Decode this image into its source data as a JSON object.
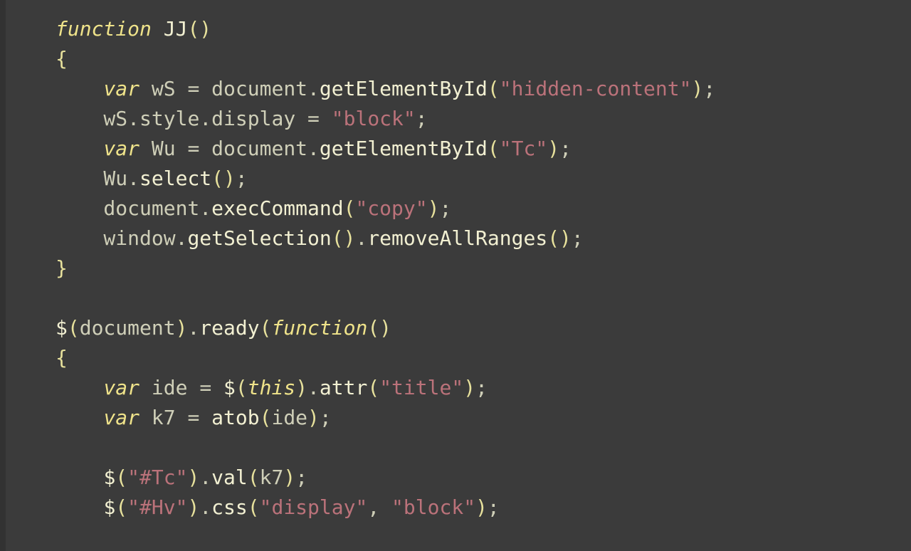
{
  "colors": {
    "background": "#3b3b3b",
    "gutter": "#323232",
    "default": "#d8d8c8",
    "keyword": "#efe38a",
    "string": "#bb727a",
    "paren": "#e7e19c"
  },
  "lines": [
    [
      {
        "t": "function",
        "c": "kw"
      },
      {
        "t": " ",
        "c": "def"
      },
      {
        "t": "JJ",
        "c": "fn"
      },
      {
        "t": "()",
        "c": "par"
      }
    ],
    [
      {
        "t": "{",
        "c": "brace"
      }
    ],
    [
      {
        "t": "    ",
        "c": "def"
      },
      {
        "t": "var",
        "c": "kw"
      },
      {
        "t": " wS ",
        "c": "def"
      },
      {
        "t": "=",
        "c": "punct"
      },
      {
        "t": " document",
        "c": "def"
      },
      {
        "t": ".",
        "c": "punct"
      },
      {
        "t": "getElementById",
        "c": "fn"
      },
      {
        "t": "(",
        "c": "par"
      },
      {
        "t": "\"hidden-content\"",
        "c": "str"
      },
      {
        "t": ")",
        "c": "par"
      },
      {
        "t": ";",
        "c": "punct"
      }
    ],
    [
      {
        "t": "    wS",
        "c": "def"
      },
      {
        "t": ".",
        "c": "punct"
      },
      {
        "t": "style",
        "c": "def"
      },
      {
        "t": ".",
        "c": "punct"
      },
      {
        "t": "display ",
        "c": "def"
      },
      {
        "t": "=",
        "c": "punct"
      },
      {
        "t": " ",
        "c": "def"
      },
      {
        "t": "\"block\"",
        "c": "str"
      },
      {
        "t": ";",
        "c": "punct"
      }
    ],
    [
      {
        "t": "    ",
        "c": "def"
      },
      {
        "t": "var",
        "c": "kw"
      },
      {
        "t": " Wu ",
        "c": "def"
      },
      {
        "t": "=",
        "c": "punct"
      },
      {
        "t": " document",
        "c": "def"
      },
      {
        "t": ".",
        "c": "punct"
      },
      {
        "t": "getElementById",
        "c": "fn"
      },
      {
        "t": "(",
        "c": "par"
      },
      {
        "t": "\"Tc\"",
        "c": "str"
      },
      {
        "t": ")",
        "c": "par"
      },
      {
        "t": ";",
        "c": "punct"
      }
    ],
    [
      {
        "t": "    Wu",
        "c": "def"
      },
      {
        "t": ".",
        "c": "punct"
      },
      {
        "t": "select",
        "c": "fn"
      },
      {
        "t": "()",
        "c": "par"
      },
      {
        "t": ";",
        "c": "punct"
      }
    ],
    [
      {
        "t": "    document",
        "c": "def"
      },
      {
        "t": ".",
        "c": "punct"
      },
      {
        "t": "execCommand",
        "c": "fn"
      },
      {
        "t": "(",
        "c": "par"
      },
      {
        "t": "\"copy\"",
        "c": "str"
      },
      {
        "t": ")",
        "c": "par"
      },
      {
        "t": ";",
        "c": "punct"
      }
    ],
    [
      {
        "t": "    window",
        "c": "def"
      },
      {
        "t": ".",
        "c": "punct"
      },
      {
        "t": "getSelection",
        "c": "fn"
      },
      {
        "t": "()",
        "c": "par"
      },
      {
        "t": ".",
        "c": "punct"
      },
      {
        "t": "removeAllRanges",
        "c": "fn"
      },
      {
        "t": "()",
        "c": "par"
      },
      {
        "t": ";",
        "c": "punct"
      }
    ],
    [
      {
        "t": "}",
        "c": "brace"
      }
    ],
    [
      {
        "t": "",
        "c": "def"
      }
    ],
    [
      {
        "t": "$",
        "c": "fn"
      },
      {
        "t": "(",
        "c": "par"
      },
      {
        "t": "document",
        "c": "def"
      },
      {
        "t": ")",
        "c": "par"
      },
      {
        "t": ".",
        "c": "punct"
      },
      {
        "t": "ready",
        "c": "fn"
      },
      {
        "t": "(",
        "c": "par"
      },
      {
        "t": "function",
        "c": "kw"
      },
      {
        "t": "()",
        "c": "par"
      }
    ],
    [
      {
        "t": "{",
        "c": "brace"
      }
    ],
    [
      {
        "t": "    ",
        "c": "def"
      },
      {
        "t": "var",
        "c": "kw"
      },
      {
        "t": " ide ",
        "c": "def"
      },
      {
        "t": "=",
        "c": "punct"
      },
      {
        "t": " ",
        "c": "def"
      },
      {
        "t": "$",
        "c": "fn"
      },
      {
        "t": "(",
        "c": "par"
      },
      {
        "t": "this",
        "c": "kw"
      },
      {
        "t": ")",
        "c": "par"
      },
      {
        "t": ".",
        "c": "punct"
      },
      {
        "t": "attr",
        "c": "fn"
      },
      {
        "t": "(",
        "c": "par"
      },
      {
        "t": "\"title\"",
        "c": "str"
      },
      {
        "t": ")",
        "c": "par"
      },
      {
        "t": ";",
        "c": "punct"
      }
    ],
    [
      {
        "t": "    ",
        "c": "def"
      },
      {
        "t": "var",
        "c": "kw"
      },
      {
        "t": " k7 ",
        "c": "def"
      },
      {
        "t": "=",
        "c": "punct"
      },
      {
        "t": " ",
        "c": "def"
      },
      {
        "t": "atob",
        "c": "fn"
      },
      {
        "t": "(",
        "c": "par"
      },
      {
        "t": "ide",
        "c": "def"
      },
      {
        "t": ")",
        "c": "par"
      },
      {
        "t": ";",
        "c": "punct"
      }
    ],
    [
      {
        "t": "",
        "c": "def"
      }
    ],
    [
      {
        "t": "    ",
        "c": "def"
      },
      {
        "t": "$",
        "c": "fn"
      },
      {
        "t": "(",
        "c": "par"
      },
      {
        "t": "\"#Tc\"",
        "c": "str"
      },
      {
        "t": ")",
        "c": "par"
      },
      {
        "t": ".",
        "c": "punct"
      },
      {
        "t": "val",
        "c": "fn"
      },
      {
        "t": "(",
        "c": "par"
      },
      {
        "t": "k7",
        "c": "def"
      },
      {
        "t": ")",
        "c": "par"
      },
      {
        "t": ";",
        "c": "punct"
      }
    ],
    [
      {
        "t": "    ",
        "c": "def"
      },
      {
        "t": "$",
        "c": "fn"
      },
      {
        "t": "(",
        "c": "par"
      },
      {
        "t": "\"#Hv\"",
        "c": "str"
      },
      {
        "t": ")",
        "c": "par"
      },
      {
        "t": ".",
        "c": "punct"
      },
      {
        "t": "css",
        "c": "fn"
      },
      {
        "t": "(",
        "c": "par"
      },
      {
        "t": "\"display\"",
        "c": "str"
      },
      {
        "t": ",",
        "c": "punct"
      },
      {
        "t": " ",
        "c": "def"
      },
      {
        "t": "\"block\"",
        "c": "str"
      },
      {
        "t": ")",
        "c": "par"
      },
      {
        "t": ";",
        "c": "punct"
      }
    ]
  ]
}
